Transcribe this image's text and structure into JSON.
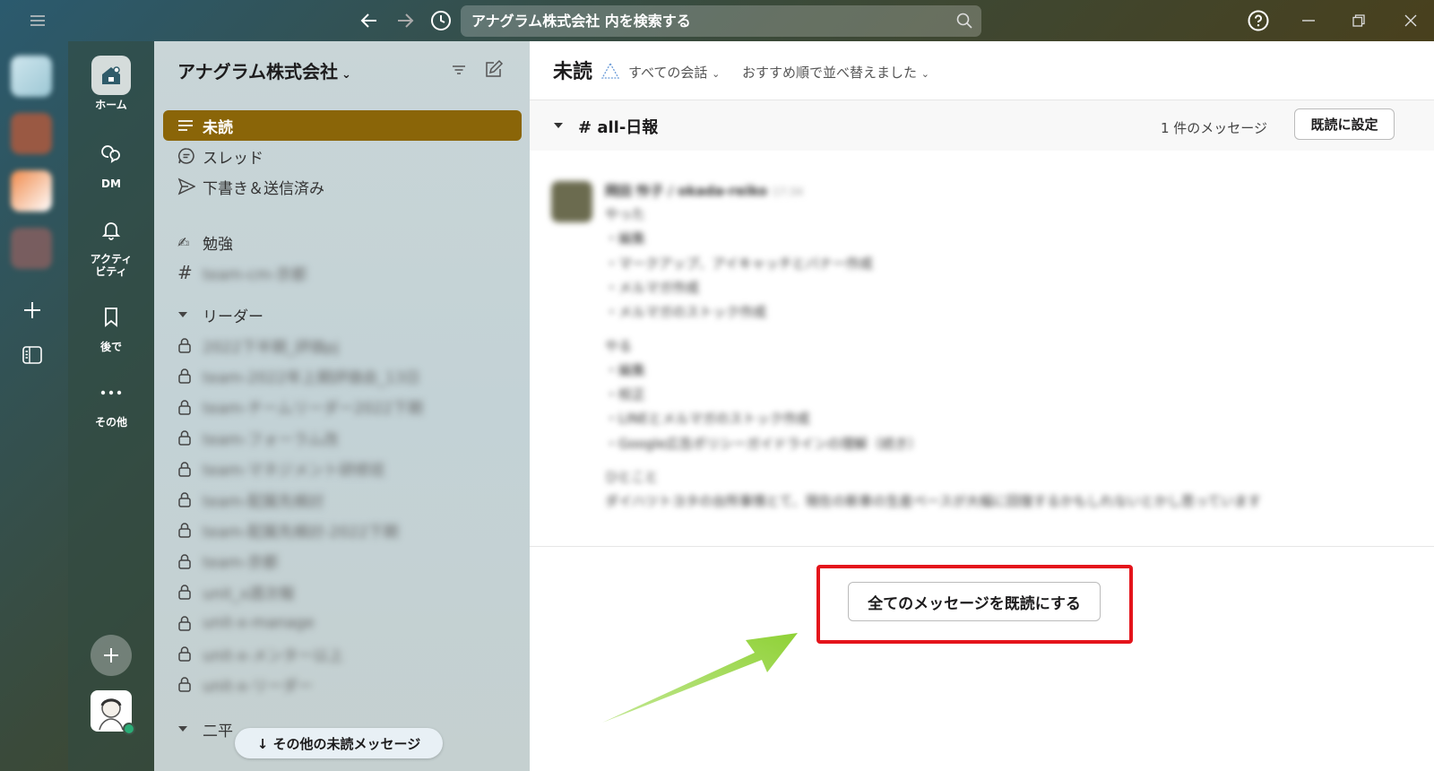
{
  "titlebar": {
    "search_placeholder": "アナグラム株式会社 内を検索する"
  },
  "nav": {
    "home": "ホーム",
    "dm": "DM",
    "activity_line1": "アクティ",
    "activity_line2": "ビティ",
    "later": "後で",
    "more": "その他"
  },
  "sidebar": {
    "workspace": "アナグラム株式会社",
    "items": {
      "unread": "未読",
      "threads": "スレッド",
      "drafts": "下書き＆送信済み"
    },
    "channels": {
      "study": "勉強",
      "blurred_channel": "team-cm-京都"
    },
    "section_leader": "リーダー",
    "private_channels": [
      "2022下半期_評価pj",
      "team-2022年上期評価会_13日",
      "team-チームリーダー2022下期",
      "team-フォーラム改",
      "team-マネジメント研修班",
      "team-配属先検討",
      "team-配属先検討-2022下期",
      "team-京都",
      "unit_x週次報",
      "unit-x-manage",
      "unit-x-メンター以上",
      "unit-x-リーダー"
    ],
    "section_second": "二平",
    "more_unread": "↓ その他の未読メッセージ"
  },
  "main": {
    "title": "未読",
    "filter_all": "すべての会話",
    "filter_sort": "おすすめ順で並べ替えました",
    "channel": "# all-日報",
    "message_count": "1 件のメッセージ",
    "mark_read_button": "既読に設定",
    "mark_all_read_button": "全てのメッセージを既読にする",
    "message": {
      "author": "岡田 怜子 / okada-reiko",
      "time": "17:34",
      "lines": [
        "やった",
        "・編集",
        "・マークアップ、アイキャッチとバナー作成",
        "・メルマガ作成",
        "・メルマガのストック作成",
        "",
        "やる",
        "・編集",
        "・校正",
        "・LINEとメルマガのストック作成",
        "・Google広告ポリシーガイドラインの理解（続き）",
        "",
        "ひとこと",
        "ダイハツトヨタの台所事情とて、現在の新車の生産ペースが大幅に回復するかもしれないとかし思っています"
      ]
    }
  }
}
